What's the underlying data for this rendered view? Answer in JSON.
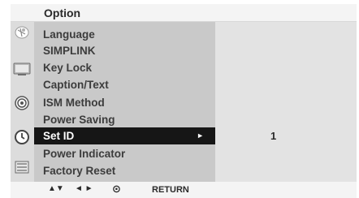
{
  "menu": {
    "title": "Option",
    "items": [
      {
        "label": "Language"
      },
      {
        "label": "SIMPLINK"
      },
      {
        "label": "Key Lock"
      },
      {
        "label": "Caption/Text"
      },
      {
        "label": "ISM Method"
      },
      {
        "label": "Power Saving"
      },
      {
        "label": "Set ID",
        "selected": true
      },
      {
        "label": "Power Indicator"
      },
      {
        "label": "Factory Reset"
      }
    ],
    "selected_arrow": "►",
    "selected_value": "1"
  },
  "icons": [
    "satellite-icon",
    "tv-icon",
    "speaker-icon",
    "clock-icon",
    "option-icon"
  ],
  "footer": {
    "updown": "▲▼",
    "leftright": "◄ ►",
    "enter": "⊙",
    "return_label": "RETURN"
  },
  "colors": {
    "header_bg": "#f4f4f4",
    "menu_bg": "#c9c9c9",
    "value_bg": "#e3e3e3",
    "selected_bg": "#161616"
  }
}
